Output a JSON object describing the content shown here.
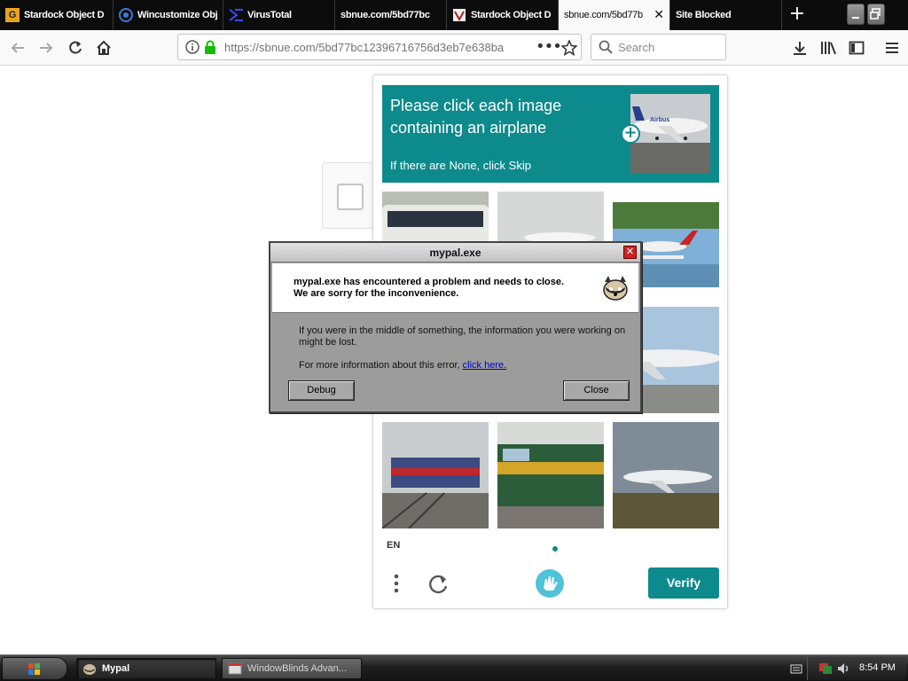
{
  "browser": {
    "tabs": [
      {
        "title": "Stardock Object D",
        "active": false,
        "icon": "stardock-g-icon"
      },
      {
        "title": "Wincustomize Object",
        "active": false,
        "icon": "wincustomize-icon"
      },
      {
        "title": "VirusTotal",
        "active": false,
        "icon": "virustotal-icon"
      },
      {
        "title": "sbnue.com/5bd77bc",
        "active": false,
        "icon": "page-icon"
      },
      {
        "title": "Stardock Object D",
        "active": false,
        "icon": "stardock-icon"
      },
      {
        "title": "sbnue.com/5bd77b",
        "active": true,
        "icon": "page-icon"
      },
      {
        "title": "Site Blocked",
        "active": false,
        "icon": "none"
      }
    ],
    "url": "https://sbnue.com/5bd77bc12396716756d3eb7e638ba",
    "search_placeholder": "Search"
  },
  "captcha": {
    "prompt_title": "Please click each image containing an airplane",
    "prompt_sub": "If there are None, click Skip",
    "language": "EN",
    "verify_label": "Verify",
    "accent_color": "#0d8a8c"
  },
  "dialog": {
    "title": "mypal.exe",
    "message": "mypal.exe has encountered a problem and needs to close.  We are sorry for the inconvenience.",
    "body1": "If you were in the middle of something, the information you were working on might be lost.",
    "body2_prefix": "For more information about this error, ",
    "link_text": "click here.",
    "debug_label": "Debug",
    "close_label": "Close"
  },
  "taskbar": {
    "tasks": [
      {
        "label": "Mypal",
        "active": true
      },
      {
        "label": "WindowBlinds Advan...",
        "active": false
      }
    ],
    "clock": "8:54 PM"
  }
}
